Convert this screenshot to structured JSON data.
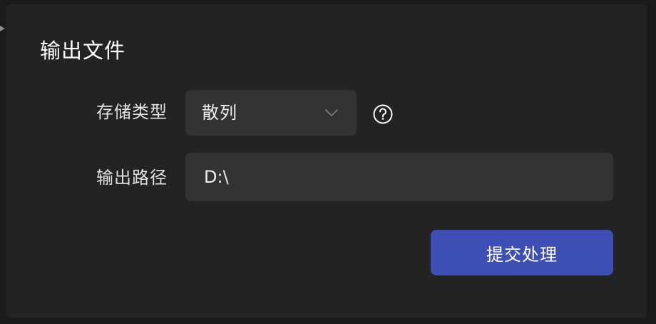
{
  "dialog": {
    "title": "输出文件"
  },
  "storage_type": {
    "label": "存储类型",
    "selected": "散列",
    "dropdown_icon": "chevron-down-icon",
    "help_icon": "question-circle-icon"
  },
  "output_path": {
    "label": "输出路径",
    "value": "D:\\"
  },
  "actions": {
    "submit_label": "提交处理"
  },
  "colors": {
    "background": "#1a1a1a",
    "panel": "#232323",
    "field": "#333333",
    "primary": "#3d4fb5",
    "text": "#ffffff"
  }
}
